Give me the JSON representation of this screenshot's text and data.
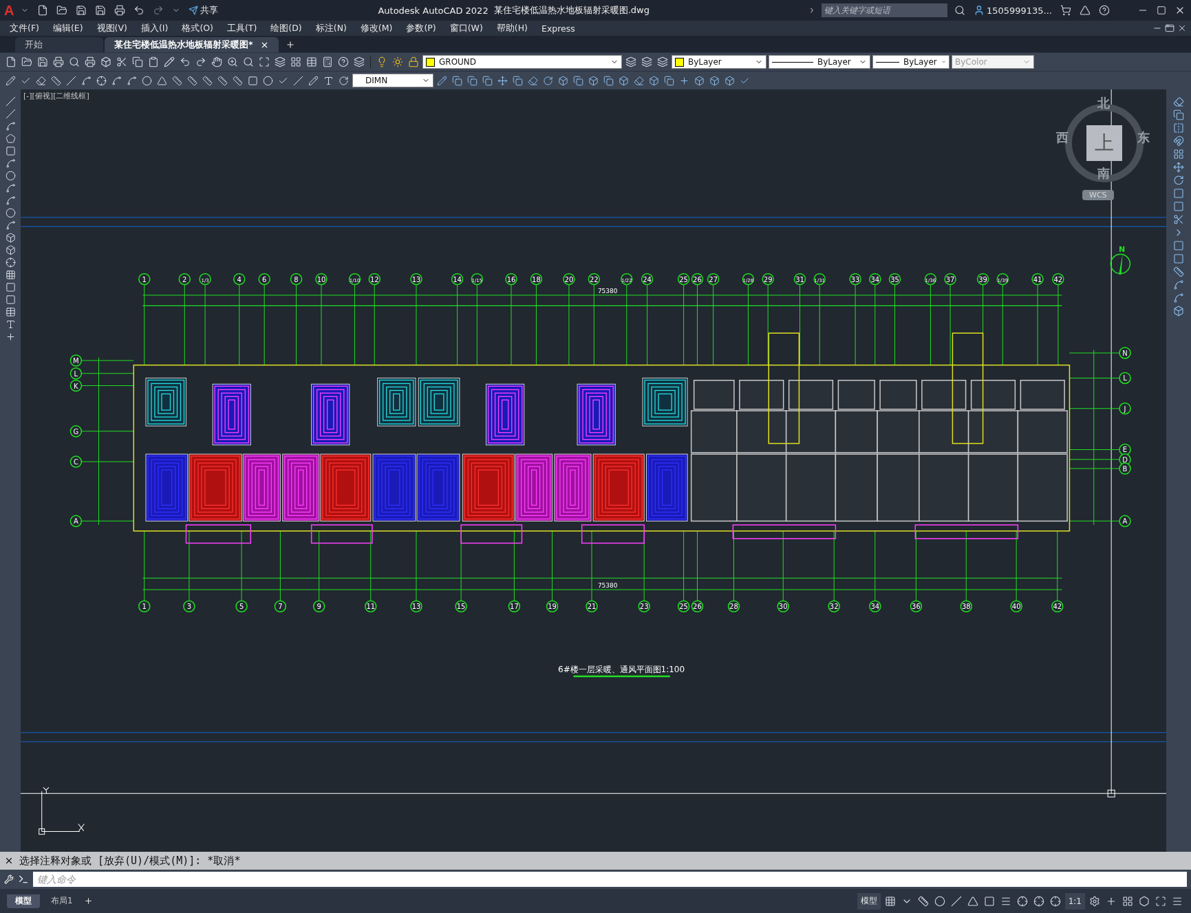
{
  "title_bar": {
    "logo": "A",
    "share": "共享",
    "app_title": "Autodesk AutoCAD 2022",
    "file_name": "某住宅楼低温热水地板辐射采暖图.dwg",
    "search": {
      "placeholder": "键入关键字或短语"
    },
    "user": "1505999135..."
  },
  "menu": [
    "文件(F)",
    "编辑(E)",
    "视图(V)",
    "插入(I)",
    "格式(O)",
    "工具(T)",
    "绘图(D)",
    "标注(N)",
    "修改(M)",
    "参数(P)",
    "窗口(W)",
    "帮助(H)",
    "Express"
  ],
  "tabs": [
    {
      "label": "开始",
      "selected": false
    },
    {
      "label": "某住宅楼低温热水地板辐射采暖图*",
      "selected": true
    }
  ],
  "properties": {
    "layer": "GROUND",
    "dim_style": "DIMN",
    "color_style": "ByLayer",
    "linetype": "ByLayer",
    "lineweight": "ByLayer",
    "plot_style": {
      "value": "ByColor",
      "disabled": true
    }
  },
  "viewport_label": "[-][俯视][二维线框]",
  "viewcube": {
    "north": "北",
    "south": "南",
    "west": "西",
    "east": "东",
    "face": "上",
    "ucs": "WCS"
  },
  "north_arrow": "N",
  "drawing": {
    "top_axes": [
      "1",
      "2",
      "1/3",
      "4",
      "6",
      "8",
      "10",
      "1/10",
      "12",
      "13",
      "14",
      "1/15",
      "16",
      "18",
      "20",
      "22",
      "1/22",
      "24",
      "25",
      "26",
      "27",
      "1/28",
      "29",
      "31",
      "1/31",
      "33",
      "34",
      "35",
      "1/36",
      "37",
      "39",
      "1/39",
      "41",
      "42"
    ],
    "bottom_axes": [
      "1",
      "3",
      "5",
      "7",
      "9",
      "11",
      "13",
      "15",
      "17",
      "19",
      "21",
      "23",
      "25",
      "26",
      "28",
      "30",
      "32",
      "34",
      "36",
      "38",
      "40",
      "42"
    ],
    "left_axes": [
      "M",
      "L",
      "K",
      "G",
      "C",
      "A"
    ],
    "right_axes": [
      "N",
      "L",
      "J",
      "E",
      "D",
      "B",
      "A"
    ],
    "top_total": "75380",
    "bottom_total": "75380",
    "title": "6#楼一层采暖、通风平面图1:100"
  },
  "command": {
    "history": "选择注释对象或 [放弃(U)/模式(M)]: *取消*",
    "placeholder": "键入命令"
  },
  "layout_tabs": [
    {
      "label": "模型",
      "selected": true
    },
    {
      "label": "布局1",
      "selected": false
    }
  ],
  "status": {
    "model": "模型",
    "scale": "1:1"
  }
}
